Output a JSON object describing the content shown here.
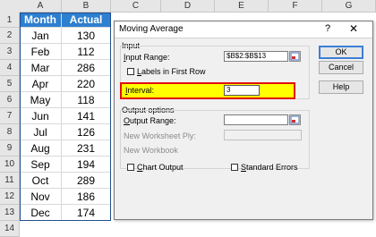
{
  "sheet": {
    "columns": [
      "A",
      "B",
      "C",
      "D",
      "E",
      "F",
      "G"
    ],
    "rows": [
      "1",
      "2",
      "3",
      "4",
      "5",
      "6",
      "7",
      "8",
      "9",
      "10",
      "11",
      "12",
      "13",
      "14"
    ],
    "header_month": "Month",
    "header_actual": "Actual",
    "data": [
      {
        "month": "Jan",
        "actual": "130"
      },
      {
        "month": "Feb",
        "actual": "112"
      },
      {
        "month": "Mar",
        "actual": "286"
      },
      {
        "month": "Apr",
        "actual": "220"
      },
      {
        "month": "May",
        "actual": "118"
      },
      {
        "month": "Jun",
        "actual": "141"
      },
      {
        "month": "Jul",
        "actual": "126"
      },
      {
        "month": "Aug",
        "actual": "231"
      },
      {
        "month": "Sep",
        "actual": "194"
      },
      {
        "month": "Oct",
        "actual": "289"
      },
      {
        "month": "Nov",
        "actual": "186"
      },
      {
        "month": "Dec",
        "actual": "174"
      }
    ],
    "colors": {
      "header_fill": "#2d7fd0",
      "header_text": "#ffffff"
    }
  },
  "dialog": {
    "title": "Moving Average",
    "help_glyph": "?",
    "close_glyph": "✕",
    "input_group": "Input",
    "input_range_label": "Input Range:",
    "input_range_value": "$B$2:$B$13",
    "labels_first_row": "Labels in First Row",
    "interval_label": "Interval:",
    "interval_value": "3",
    "output_group": "Output options",
    "output_range_label": "Output Range:",
    "output_range_value": "",
    "new_ply_label": "New Worksheet Ply:",
    "new_workbook_label": "New Workbook",
    "chart_output": "Chart Output",
    "standard_errors": "Standard Errors",
    "ok": "OK",
    "cancel": "Cancel",
    "help": "Help",
    "colors": {
      "interval_highlight": "#ffff00",
      "highlight_border": "#e01010",
      "default_button_border": "#3c7fd6"
    }
  }
}
